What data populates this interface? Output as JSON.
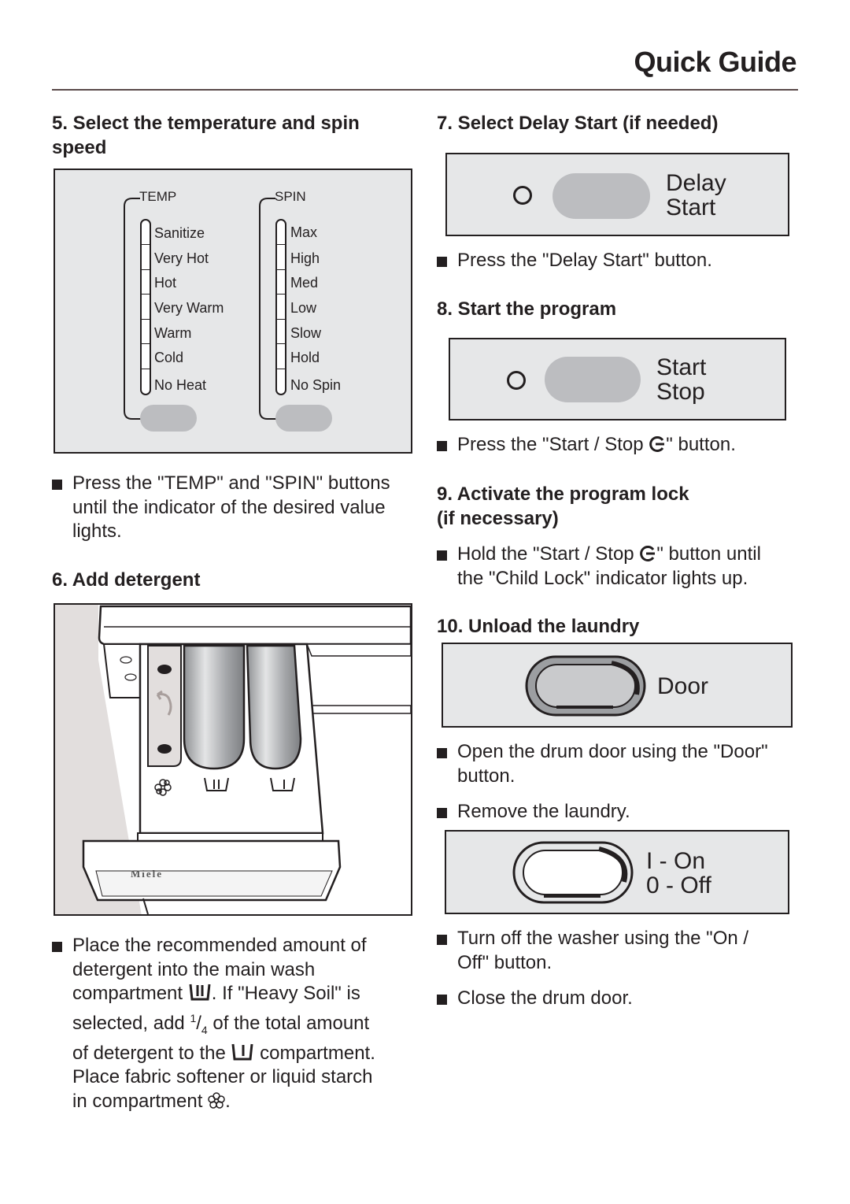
{
  "header": {
    "title": "Quick Guide"
  },
  "steps": {
    "s5": {
      "heading_line1": "5. Select the temperature and spin",
      "heading_line2": "speed",
      "temp": {
        "label": "TEMP",
        "options": [
          "Sanitize",
          "Very Hot",
          "Hot",
          "Very Warm",
          "Warm",
          "Cold",
          "No Heat"
        ]
      },
      "spin": {
        "label": "SPIN",
        "options": [
          "Max",
          "High",
          "Med",
          "Low",
          "Slow",
          "Hold",
          "No Spin"
        ]
      },
      "bullet_lines": [
        "Press the \"TEMP\" and \"SPIN\" buttons",
        "until the indicator of the desired value",
        "lights."
      ]
    },
    "s6": {
      "heading": "6. Add detergent",
      "drawer_brand": "Miele",
      "bullet": {
        "line1": "Place the recommended amount of",
        "line2": "detergent into the main wash",
        "line3a": "compartment",
        "line3b": ". If \"Heavy Soil\" is",
        "line4a": "selected, add",
        "frac_num": "1",
        "frac_den": "4",
        "line4b": "of the total amount",
        "line5a": "of detergent to the",
        "line5b": "compartment.",
        "line6": "Place fabric softener or liquid starch",
        "line7a": "in compartment",
        "line7b": "."
      }
    },
    "s7": {
      "heading": "7. Select Delay Start (if needed)",
      "button_label_1": "Delay",
      "button_label_2": "Start",
      "bullet": "Press the \"Delay Start\" button."
    },
    "s8": {
      "heading": "8. Start the program",
      "button_label_1": "Start",
      "button_label_2": "Stop",
      "bullet_a": "Press the \"Start / Stop",
      "bullet_b": "\" button."
    },
    "s9": {
      "heading_line1": "9. Activate the program lock",
      "heading_line2": "(if necessary)",
      "bullet_line1a": "Hold the \"Start / Stop",
      "bullet_line1b": "\" button until",
      "bullet_line2": "the \"Child Lock\" indicator lights up."
    },
    "s10": {
      "heading": "10. Unload the laundry",
      "door_label": "Door",
      "bullet1_line1": "Open the drum door using the \"Door\"",
      "bullet1_line2": "button.",
      "bullet2": "Remove the laundry.",
      "onoff_label_1": "I - On",
      "onoff_label_2": "0 - Off",
      "bullet3_line1": "Turn off the washer using the \"On /",
      "bullet3_line2": "Off\" button.",
      "bullet4": "Close the drum door."
    }
  }
}
